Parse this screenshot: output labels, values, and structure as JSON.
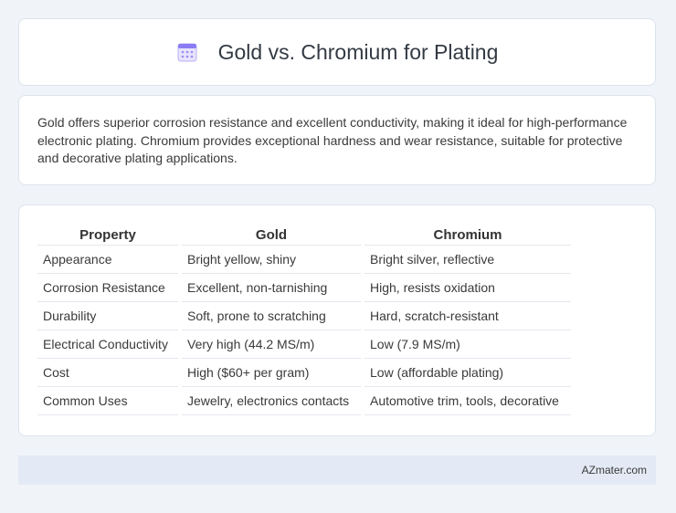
{
  "header": {
    "title": "Gold vs. Chromium for Plating",
    "icon": "calendar-icon"
  },
  "summary": {
    "text": "Gold offers superior corrosion resistance and excellent conductivity, making it ideal for high-performance electronic plating. Chromium provides exceptional hardness and wear resistance, suitable for protective and decorative plating applications."
  },
  "table": {
    "headers": [
      "Property",
      "Gold",
      "Chromium"
    ],
    "rows": [
      [
        "Appearance",
        "Bright yellow, shiny",
        "Bright silver, reflective"
      ],
      [
        "Corrosion Resistance",
        "Excellent, non-tarnishing",
        "High, resists oxidation"
      ],
      [
        "Durability",
        "Soft, prone to scratching",
        "Hard, scratch-resistant"
      ],
      [
        "Electrical Conductivity",
        "Very high (44.2 MS/m)",
        "Low (7.9 MS/m)"
      ],
      [
        "Cost",
        "High ($60+ per gram)",
        "Low (affordable plating)"
      ],
      [
        "Common Uses",
        "Jewelry, electronics contacts",
        "Automotive trim, tools, decorative"
      ]
    ]
  },
  "footer": {
    "brand": "AZmater.com"
  },
  "colors": {
    "background": "#f0f4f9",
    "footer": "#e3eaf5",
    "icon_accent": "#7c6cf0"
  }
}
